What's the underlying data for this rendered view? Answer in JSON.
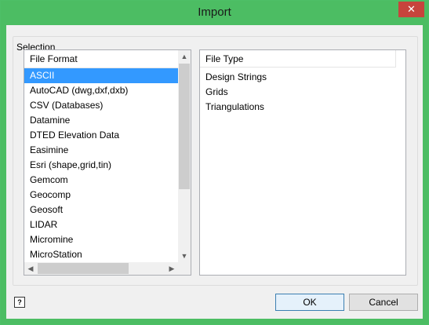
{
  "window": {
    "title": "Import",
    "close_label": "✕"
  },
  "selection": {
    "group_label": "Selection",
    "file_format": {
      "header": "File Format",
      "items": [
        "ASCII",
        "AutoCAD (dwg,dxf,dxb)",
        "CSV (Databases)",
        "Datamine",
        "DTED Elevation Data",
        "Easimine",
        "Esri (shape,grid,tin)",
        "Gemcom",
        "Geocomp",
        "Geosoft",
        "LIDAR",
        "Micromine",
        "MicroStation"
      ],
      "selected_index": 0
    },
    "file_type": {
      "header": "File Type",
      "items": [
        "Design Strings",
        "Grids",
        "Triangulations"
      ]
    }
  },
  "scrollbars": {
    "up_arrow": "▲",
    "down_arrow": "▼",
    "left_arrow": "◀",
    "right_arrow": "▶"
  },
  "buttons": {
    "ok": "OK",
    "cancel": "Cancel",
    "help": "?"
  },
  "colors": {
    "title_bar": "#4cbd63",
    "selection": "#3399ff",
    "close": "#c7443c"
  }
}
